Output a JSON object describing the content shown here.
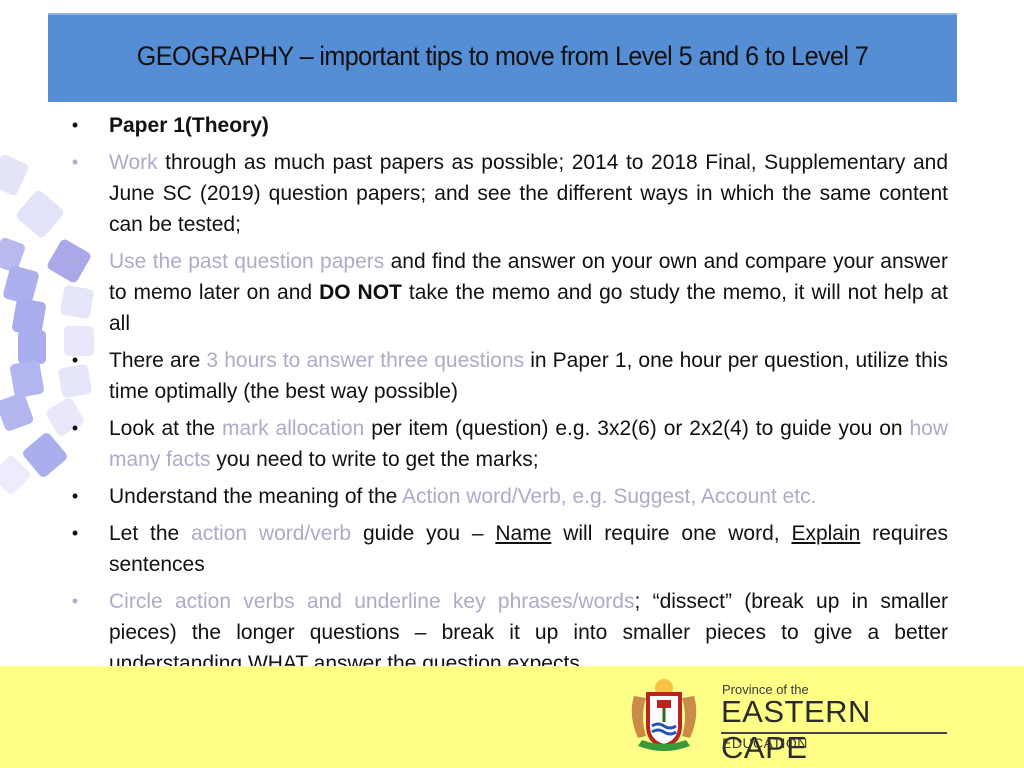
{
  "header": {
    "title": "GEOGRAPHY – important tips to move from Level 5 and 6 to  Level 7"
  },
  "colors": {
    "header_bg": "#558ed5",
    "footer_bg": "#ffff88",
    "highlight_text": "#aeaac8",
    "body_text": "#111111"
  },
  "bullets": [
    {
      "style": "dark",
      "runs": [
        {
          "t": "Paper 1(Theory)",
          "s": "bold"
        }
      ]
    },
    {
      "style": "muted",
      "runs": [
        {
          "t": "Work",
          "s": "muted"
        },
        {
          "t": " through as much past papers as possible; 2014 to 2018 Final, Supplementary and June SC (2019) question papers; and see the different ways in which the same content can be tested;",
          "s": ""
        }
      ]
    },
    {
      "style": "muted",
      "runs": [
        {
          "t": "Use the past question papers",
          "s": "muted"
        },
        {
          "t": " and find the answer on your own and compare your answer to memo later on and ",
          "s": ""
        },
        {
          "t": "DO NOT",
          "s": "bold"
        },
        {
          "t": " take the memo and go study the memo, it will not help at all",
          "s": ""
        }
      ]
    },
    {
      "style": "dark",
      "runs": [
        {
          "t": "There are ",
          "s": ""
        },
        {
          "t": "3 hours to answer three questions",
          "s": "muted"
        },
        {
          "t": " in Paper 1, one hour per question, utilize this time optimally (the best way possible)",
          "s": ""
        }
      ]
    },
    {
      "style": "dark",
      "runs": [
        {
          "t": "Look at the ",
          "s": ""
        },
        {
          "t": "mark allocation",
          "s": "muted"
        },
        {
          "t": " per item (question) e.g. 3x2(6) or 2x2(4) to guide you on ",
          "s": ""
        },
        {
          "t": "how many facts",
          "s": "muted"
        },
        {
          "t": " you need to write to get the marks;",
          "s": ""
        }
      ]
    },
    {
      "style": "dark",
      "runs": [
        {
          "t": "Understand the meaning of the ",
          "s": ""
        },
        {
          "t": "Action word/Verb, e.g. Suggest, Account etc.",
          "s": "muted"
        }
      ]
    },
    {
      "style": "dark",
      "runs": [
        {
          "t": "Let the ",
          "s": ""
        },
        {
          "t": "action word/verb",
          "s": "muted"
        },
        {
          "t": " guide you – ",
          "s": ""
        },
        {
          "t": "Name",
          "s": "u"
        },
        {
          "t": " will require one word, ",
          "s": ""
        },
        {
          "t": "Explain",
          "s": "u"
        },
        {
          "t": " requires sentences",
          "s": ""
        }
      ]
    },
    {
      "style": "muted",
      "runs": [
        {
          "t": "Circle action verbs and underline key phrases/words",
          "s": "muted"
        },
        {
          "t": "; “dissect” (break up in smaller pieces) the longer questions – break it up into  smaller pieces to give a better understanding WHAT answer the question expects.",
          "s": ""
        }
      ]
    }
  ],
  "bullet_char": "•",
  "logo": {
    "small": "Province of the",
    "big": "EASTERN CAPE",
    "sub": "EDUCATION",
    "icon": "coat-of-arms-icon"
  }
}
